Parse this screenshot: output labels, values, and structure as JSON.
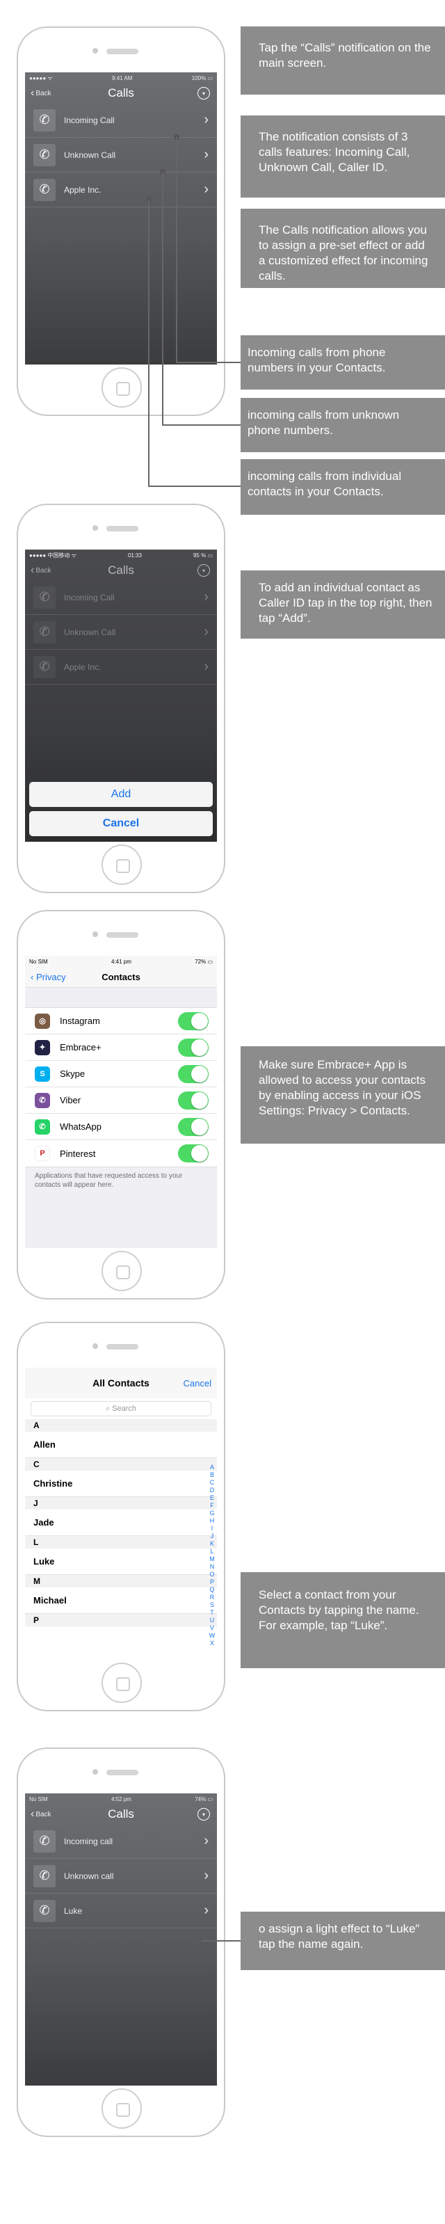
{
  "screen1": {
    "status": {
      "carrier": "●●●●● ᯤ",
      "time": "9:41 AM",
      "battery": "100% ▭"
    },
    "nav": {
      "back": "Back",
      "title": "Calls"
    },
    "rows": [
      {
        "label": "Incoming Call"
      },
      {
        "label": "Unknown Call"
      },
      {
        "label": "Apple Inc."
      }
    ],
    "callouts": [
      "Tap the “Calls” notification on the main screen.",
      "The notification consists of 3 calls features: Incoming Call, Unknown Call, Caller ID.",
      "The Calls notification allows you to assign a pre-set effect or add a customized effect for incoming calls.",
      "Incoming calls from phone numbers in your Contacts.",
      "incoming calls from unknown phone numbers.",
      "incoming calls from individual contacts in your Contacts."
    ]
  },
  "screen2": {
    "status": {
      "carrier": "●●●●● 中国移动 ᯤ",
      "time": "01:33",
      "battery": "95 % ▭"
    },
    "nav": {
      "back": "Back",
      "title": "Calls"
    },
    "rows": [
      {
        "label": "Incoming Call"
      },
      {
        "label": "Unknown Call"
      },
      {
        "label": "Apple Inc."
      }
    ],
    "add_label": "Add",
    "cancel_label": "Cancel",
    "callout": "To add an individual contact as Caller ID tap in the top right, then tap “Add”."
  },
  "screen3": {
    "status": {
      "carrier": "No SIM",
      "time": "4:41 pm",
      "battery": "72% ▭"
    },
    "nav": {
      "back": "Privacy",
      "title": "Contacts"
    },
    "apps": [
      {
        "name": "Instagram",
        "color": "#7a5c45",
        "glyph": "◎"
      },
      {
        "name": "Embrace+",
        "color": "#222244",
        "glyph": "✦"
      },
      {
        "name": "Skype",
        "color": "#00aff0",
        "glyph": "S"
      },
      {
        "name": "Viber",
        "color": "#7b519d",
        "glyph": "✆"
      },
      {
        "name": "WhatsApp",
        "color": "#25d366",
        "glyph": "✆"
      },
      {
        "name": "Pinterest",
        "color": "#ffffff",
        "glyph": "P"
      }
    ],
    "footnote": "Applications that have requested access to your contacts will appear here.",
    "callout": "Make sure Embrace+ App is allowed to access your contacts by enabling access in your iOS Settings: Privacy > Contacts."
  },
  "screen4": {
    "title": "All Contacts",
    "cancel": "Cancel",
    "search_placeholder": "Search",
    "list": [
      {
        "type": "head",
        "text": "A"
      },
      {
        "type": "row",
        "text": "Allen"
      },
      {
        "type": "head",
        "text": "C"
      },
      {
        "type": "row",
        "text": "Christine"
      },
      {
        "type": "head",
        "text": "J"
      },
      {
        "type": "row",
        "text": "Jade"
      },
      {
        "type": "head",
        "text": "L"
      },
      {
        "type": "row",
        "text": "Luke"
      },
      {
        "type": "head",
        "text": "M"
      },
      {
        "type": "row",
        "text": "Michael"
      },
      {
        "type": "head",
        "text": "P"
      }
    ],
    "index": [
      "A",
      "B",
      "C",
      "D",
      "E",
      "F",
      "G",
      "H",
      "I",
      "J",
      "K",
      "L",
      "M",
      "N",
      "O",
      "P",
      "Q",
      "R",
      "S",
      "T",
      "U",
      "V",
      "W",
      "X"
    ],
    "callout": "Select a contact from your Contacts by tapping the name. For example, tap “Luke”."
  },
  "screen5": {
    "status": {
      "carrier": "No SIM",
      "time": "4:52 pm",
      "battery": "74% ▭"
    },
    "nav": {
      "back": "Back",
      "title": "Calls"
    },
    "rows": [
      {
        "label": "Incoming call"
      },
      {
        "label": "Unknown call"
      },
      {
        "label": "Luke"
      }
    ],
    "callout": "o assign a light effect to “Luke” tap the name again."
  }
}
